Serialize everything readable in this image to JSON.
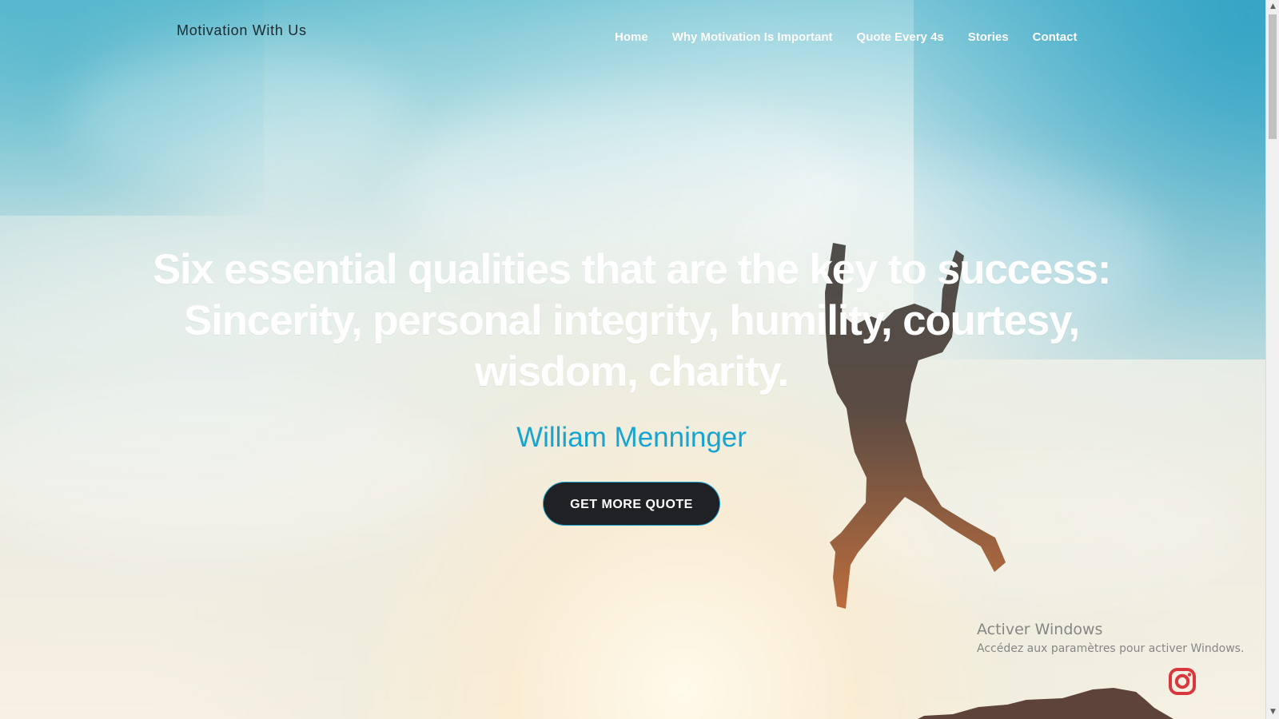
{
  "header": {
    "brand": "Motivation With Us",
    "nav_items": [
      {
        "label": "Home"
      },
      {
        "label": "Why Motivation Is Important"
      },
      {
        "label": "Quote Every 4s"
      },
      {
        "label": "Stories"
      },
      {
        "label": "Contact"
      }
    ]
  },
  "hero": {
    "quote": "Six essential qualities that are the key to success: Sincerity, personal integrity, humility, courtesy, wisdom, charity.",
    "author": "William Menninger",
    "cta_label": "GET MORE QUOTE"
  },
  "overlay": {
    "windows_title": "Activer Windows",
    "windows_subtitle": "Accédez aux paramètres pour activer Windows."
  },
  "icons": {
    "instagram": "instagram-icon",
    "scroll_up": "scroll-up-arrow-icon",
    "scroll_down": "scroll-down-arrow-icon"
  },
  "colors": {
    "accent": "#18a4d1",
    "button": "#202124",
    "instagram": "#d8373d",
    "nav_text": "#ffffff"
  }
}
